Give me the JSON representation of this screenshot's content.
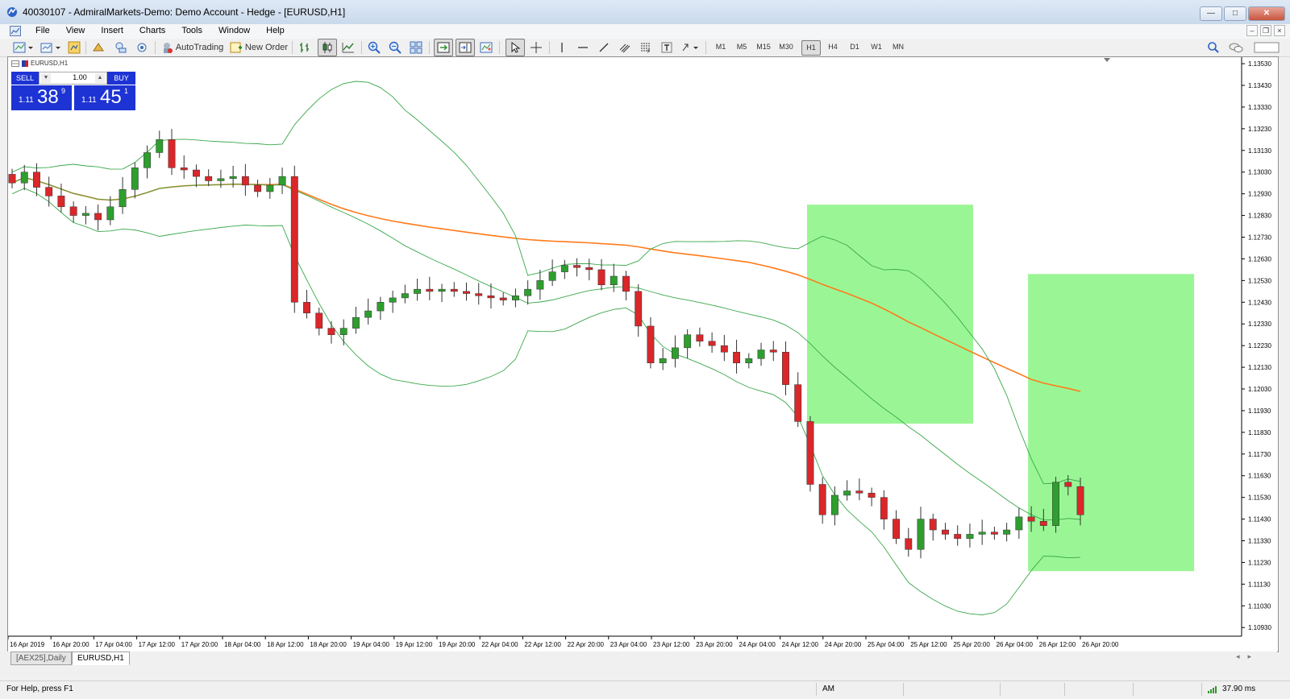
{
  "window": {
    "title": "40030107 - AdmiralMarkets-Demo: Demo Account - Hedge - [EURUSD,H1]"
  },
  "menu": [
    "File",
    "View",
    "Insert",
    "Charts",
    "Tools",
    "Window",
    "Help"
  ],
  "toolbar": {
    "autotrading": "AutoTrading",
    "new_order": "New Order",
    "timeframes": [
      "M1",
      "M5",
      "M15",
      "M30",
      "H1",
      "H4",
      "D1",
      "W1",
      "MN"
    ],
    "active_timeframe": "H1"
  },
  "chart": {
    "label": "EURUSD,H1"
  },
  "trade_panel": {
    "sell_label": "SELL",
    "buy_label": "BUY",
    "volume": "1.00",
    "sell": {
      "big": "1.11",
      "main": "38",
      "sup": "9"
    },
    "buy": {
      "big": "1.11",
      "main": "45",
      "sup": "1"
    }
  },
  "tabs": [
    "[AEX25],Daily",
    "EURUSD,H1"
  ],
  "active_tab": "EURUSD,H1",
  "status": {
    "help": "For Help, press F1",
    "profile": "AM",
    "ping": "37.90 ms"
  },
  "chart_data": {
    "type": "candlestick",
    "symbol": "EURUSD",
    "timeframe": "H1",
    "y_ticks": [
      "1.13530",
      "1.13430",
      "1.13330",
      "1.13230",
      "1.13130",
      "1.13030",
      "1.12930",
      "1.12830",
      "1.12730",
      "1.12630",
      "1.12530",
      "1.12430",
      "1.12330",
      "1.12230",
      "1.12130",
      "1.12030",
      "1.11930",
      "1.11830",
      "1.11730",
      "1.11630",
      "1.11530",
      "1.11430",
      "1.11330",
      "1.11230",
      "1.11130",
      "1.11030",
      "1.10930"
    ],
    "x_ticks": [
      "16 Apr 2019",
      "16 Apr 20:00",
      "17 Apr 04:00",
      "17 Apr 12:00",
      "17 Apr 20:00",
      "18 Apr 04:00",
      "18 Apr 12:00",
      "18 Apr 20:00",
      "19 Apr 04:00",
      "19 Apr 12:00",
      "19 Apr 20:00",
      "22 Apr 04:00",
      "22 Apr 12:00",
      "22 Apr 20:00",
      "23 Apr 04:00",
      "23 Apr 12:00",
      "23 Apr 20:00",
      "24 Apr 04:00",
      "24 Apr 12:00",
      "24 Apr 20:00",
      "25 Apr 04:00",
      "25 Apr 12:00",
      "25 Apr 20:00",
      "26 Apr 04:00",
      "26 Apr 12:00",
      "26 Apr 20:00"
    ],
    "ylim": [
      1.1089,
      1.1356
    ],
    "closes": [
      1.1298,
      1.1303,
      1.1296,
      1.1292,
      1.1287,
      1.1283,
      1.1284,
      1.1281,
      1.1287,
      1.1295,
      1.1305,
      1.1312,
      1.1318,
      1.1305,
      1.1304,
      1.1301,
      1.1299,
      1.13,
      1.1301,
      1.1297,
      1.1294,
      1.1297,
      1.1301,
      1.1243,
      1.1238,
      1.1231,
      1.1228,
      1.1231,
      1.1236,
      1.1239,
      1.1243,
      1.1245,
      1.1247,
      1.1249,
      1.1248,
      1.1249,
      1.1248,
      1.1247,
      1.1246,
      1.1245,
      1.1244,
      1.1246,
      1.1249,
      1.1253,
      1.1257,
      1.126,
      1.1259,
      1.1258,
      1.1251,
      1.1255,
      1.1248,
      1.1232,
      1.1215,
      1.1217,
      1.1222,
      1.1228,
      1.1225,
      1.1223,
      1.122,
      1.1215,
      1.1217,
      1.1221,
      1.122,
      1.1205,
      1.1188,
      1.1159,
      1.1145,
      1.1154,
      1.1156,
      1.1155,
      1.1153,
      1.1143,
      1.1134,
      1.1129,
      1.1143,
      1.1138,
      1.1136,
      1.1134,
      1.1136,
      1.1137,
      1.1136,
      1.1138,
      1.1144,
      1.1142,
      1.114,
      1.116,
      1.1158,
      1.1145
    ],
    "overlays": [
      "Bollinger Bands (green)",
      "Moving Average (orange)"
    ],
    "highlight_zones": 2
  }
}
